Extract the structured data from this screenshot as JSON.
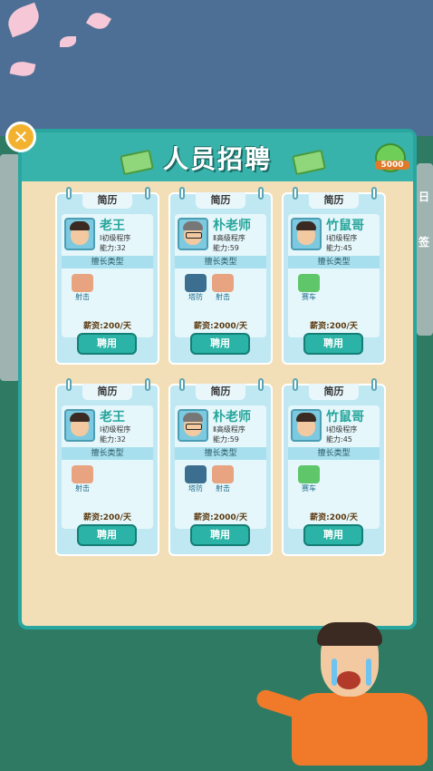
{
  "window": {
    "title": "人员招聘",
    "coin_badge": "5000",
    "close_icon": "close-icon"
  },
  "skills_header": "擅长类型",
  "resume_label": "简历",
  "candidates": [
    {
      "name": "老王",
      "level": "Ⅰ初级程序",
      "ability": "能力:32",
      "skills": [
        "射击"
      ],
      "salary": "薪资:200/天",
      "hire": "聘用",
      "glasses": false
    },
    {
      "name": "朴老师",
      "level": "Ⅱ高级程序",
      "ability": "能力:59",
      "skills": [
        "塔防",
        "射击"
      ],
      "salary": "薪资:2000/天",
      "hire": "聘用",
      "glasses": true
    },
    {
      "name": "竹鼠哥",
      "level": "Ⅰ初级程序",
      "ability": "能力:45",
      "skills": [
        "赛车"
      ],
      "salary": "薪资:200/天",
      "hire": "聘用",
      "glasses": false
    },
    {
      "name": "老王",
      "level": "Ⅰ初级程序",
      "ability": "能力:32",
      "skills": [
        "射击"
      ],
      "salary": "薪资:200/天",
      "hire": "聘用",
      "glasses": false
    },
    {
      "name": "朴老师",
      "level": "Ⅱ高级程序",
      "ability": "能力:59",
      "skills": [
        "塔防",
        "射击"
      ],
      "salary": "薪资:2000/天",
      "hire": "聘用",
      "glasses": true
    },
    {
      "name": "竹鼠哥",
      "level": "Ⅰ初级程序",
      "ability": "能力:45",
      "skills": [
        "赛车"
      ],
      "salary": "薪资:200/天",
      "hire": "聘用",
      "glasses": false
    }
  ],
  "background": {
    "side_text_1": "日",
    "side_text_2": "签"
  },
  "colors": {
    "teal": "#2aa6a0",
    "panel": "#f3dfb7",
    "name": "#27a59b"
  },
  "skill_icons": {
    "射击": "gun-icon",
    "塔防": "tower-icon",
    "赛车": "racing-helmet-icon"
  }
}
